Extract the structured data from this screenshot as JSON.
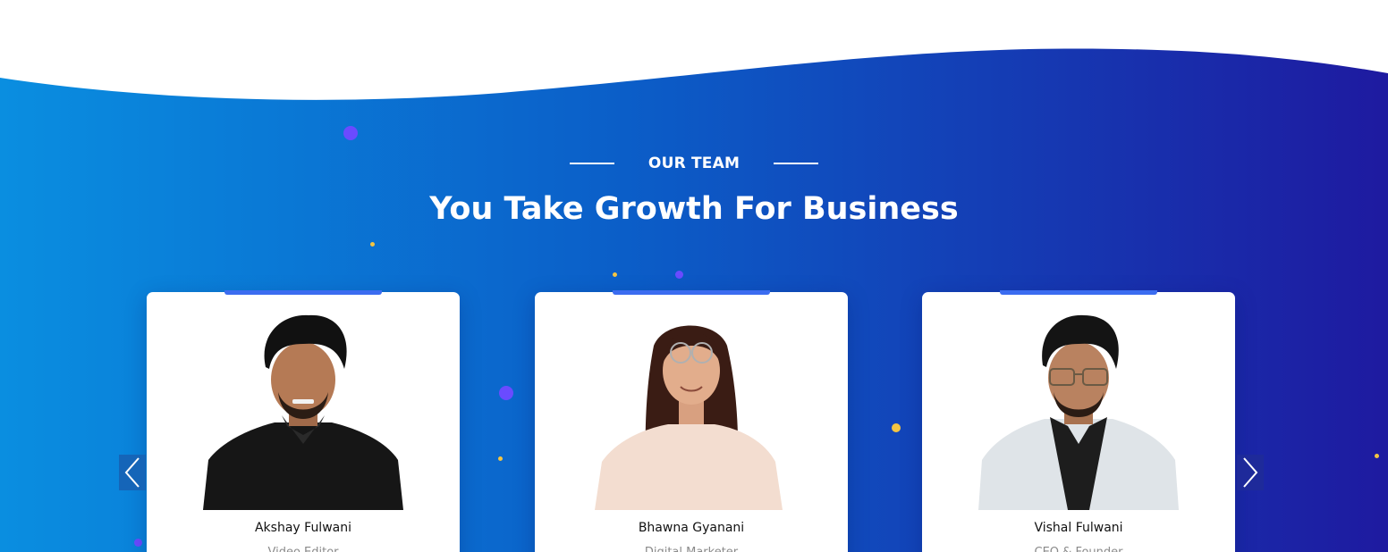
{
  "section": {
    "eyebrow": "OUR TEAM",
    "title": "You Take Growth For Business"
  },
  "colors": {
    "gradient_start": "#0a8ee0",
    "gradient_mid": "#0b5ec8",
    "gradient_end": "#1e1aa0",
    "accent": "#3b6cf0",
    "dot_purple": "#6a4bff",
    "dot_yellow": "#f4c542"
  },
  "carousel": {
    "prev_icon": "chevron-left-icon",
    "next_icon": "chevron-right-icon"
  },
  "team": [
    {
      "name": "Akshay Fulwani",
      "role": "Video Editor"
    },
    {
      "name": "Bhawna Gyanani",
      "role": "Digital Marketer"
    },
    {
      "name": "Vishal Fulwani",
      "role": "CEO & Founder"
    }
  ]
}
